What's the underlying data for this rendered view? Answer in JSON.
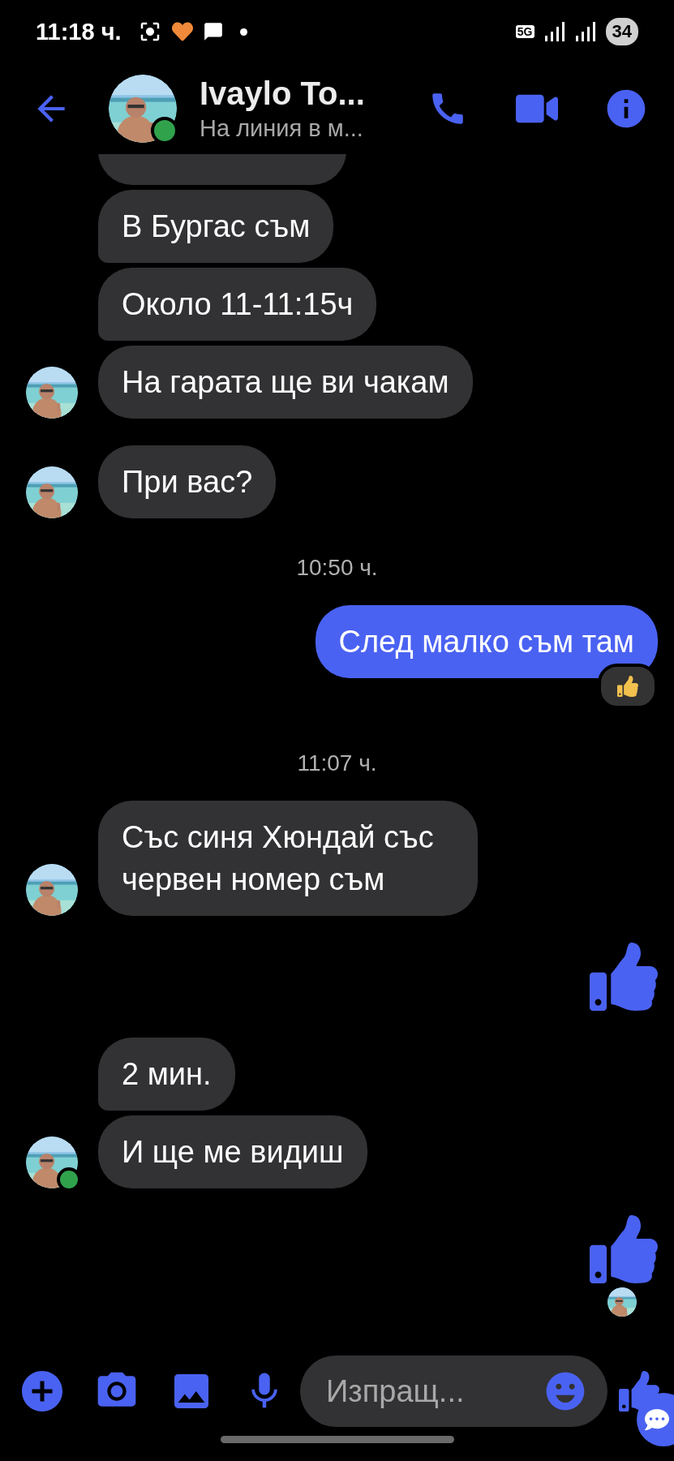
{
  "status_bar": {
    "time": "11:18 ч.",
    "network": "5G",
    "battery": "34"
  },
  "header": {
    "name": "Ivaylo To...",
    "subtitle": "На линия в м...",
    "online": true
  },
  "messages": [
    {
      "kind": "clipped"
    },
    {
      "kind": "incoming",
      "text": "В Бургас съм",
      "avatar": false
    },
    {
      "kind": "incoming",
      "text": "Около 11-11:15ч",
      "avatar": false
    },
    {
      "kind": "incoming",
      "text": "На гарата ще ви чакам",
      "avatar": true,
      "online": false
    },
    {
      "kind": "incoming",
      "text": "При вас?",
      "avatar": true,
      "online": false
    },
    {
      "kind": "time",
      "text": "10:50 ч."
    },
    {
      "kind": "outgoing",
      "text": "След малко съм там",
      "reaction": true
    },
    {
      "kind": "time",
      "text": "11:07 ч."
    },
    {
      "kind": "incoming",
      "text": "Със синя Хюндай със червен номер съм",
      "avatar": true,
      "online": false
    },
    {
      "kind": "like",
      "seen": false
    },
    {
      "kind": "incoming",
      "text": "2 мин.",
      "avatar": false
    },
    {
      "kind": "incoming",
      "text": "И ще ме видиш",
      "avatar": true,
      "online": true
    },
    {
      "kind": "like",
      "seen": true
    }
  ],
  "composer": {
    "placeholder": "Изпращ..."
  }
}
